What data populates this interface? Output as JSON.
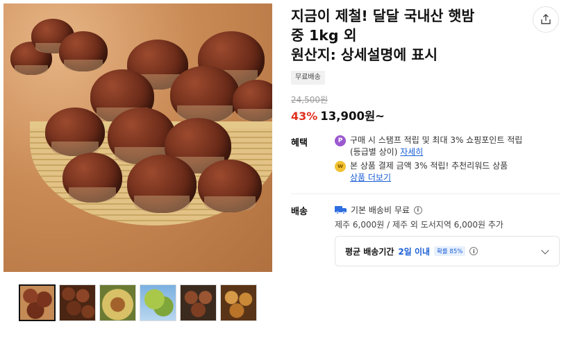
{
  "product": {
    "title_lines": [
      "지금이 제철! 달달 국내산 햇밤",
      "중 1kg 외",
      "원산지: 상세설명에 표시"
    ],
    "badge": "무료배송",
    "original_price": "24,500원",
    "discount": "43%",
    "price": "13,900원~"
  },
  "gallery": {
    "thumbnails": [
      "chestnut-basket",
      "chestnut-pile",
      "chestnut-burr",
      "chestnut-tree",
      "chestnut-closeup",
      "roasted-chestnuts"
    ],
    "selected_index": 0
  },
  "benefits": {
    "label": "혜택",
    "items": [
      {
        "icon": "point-coin-icon",
        "icon_text": "P",
        "text": "구매 시 스탬프 적립 및 최대 3% 쇼핑포인트 적립",
        "text2": "(등급별 상이)",
        "link": "자세히"
      },
      {
        "icon": "gold-coin-icon",
        "icon_text": "w",
        "text": "본 상품 결제 금액 3% 적립! 추천리워드 상품",
        "link": "상품 더보기"
      }
    ]
  },
  "shipping": {
    "label": "배송",
    "base": "기본 배송비 무료",
    "extra": "제주 6,000원 / 제주 외 도서지역 6,000원 추가",
    "delivery_label": "평균 배송기간",
    "delivery_value": "2일 이내",
    "probability": "확률 85%"
  },
  "colors": {
    "discount": "#e0301e",
    "link": "#1a5fd6",
    "truck": "#2f6ee0"
  }
}
